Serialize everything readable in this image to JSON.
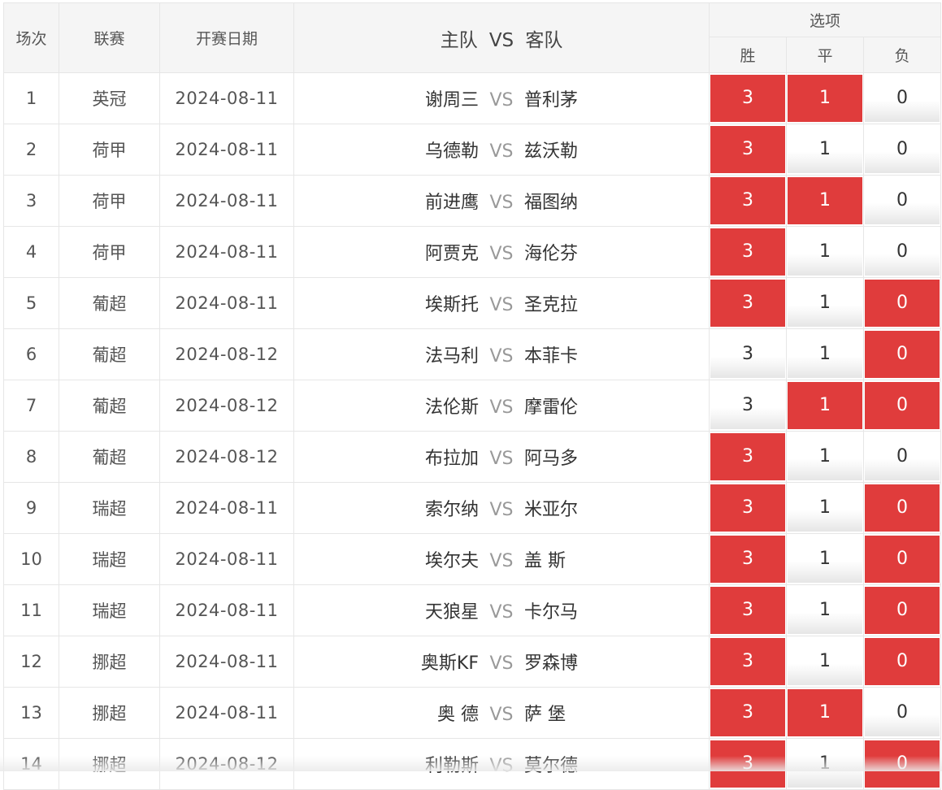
{
  "header": {
    "col_index": "场次",
    "col_league": "联赛",
    "col_date": "开赛日期",
    "col_home": "主队",
    "col_vs": "VS",
    "col_away": "客队",
    "col_options": "选项",
    "opt_win": "胜",
    "opt_draw": "平",
    "opt_lose": "负"
  },
  "colors": {
    "selected": "#e03c3c",
    "unselected": "#ffffff"
  },
  "rows": [
    {
      "idx": "1",
      "league": "英冠",
      "date": "2024-08-11",
      "home": "谢周三",
      "vs": "VS",
      "away": "普利茅",
      "win": {
        "label": "3",
        "selected": true
      },
      "draw": {
        "label": "1",
        "selected": true
      },
      "lose": {
        "label": "0",
        "selected": false
      }
    },
    {
      "idx": "2",
      "league": "荷甲",
      "date": "2024-08-11",
      "home": "乌德勒",
      "vs": "VS",
      "away": "兹沃勒",
      "win": {
        "label": "3",
        "selected": true
      },
      "draw": {
        "label": "1",
        "selected": false
      },
      "lose": {
        "label": "0",
        "selected": false
      }
    },
    {
      "idx": "3",
      "league": "荷甲",
      "date": "2024-08-11",
      "home": "前进鹰",
      "vs": "VS",
      "away": "福图纳",
      "win": {
        "label": "3",
        "selected": true
      },
      "draw": {
        "label": "1",
        "selected": true
      },
      "lose": {
        "label": "0",
        "selected": false
      }
    },
    {
      "idx": "4",
      "league": "荷甲",
      "date": "2024-08-11",
      "home": "阿贾克",
      "vs": "VS",
      "away": "海伦芬",
      "win": {
        "label": "3",
        "selected": true
      },
      "draw": {
        "label": "1",
        "selected": false
      },
      "lose": {
        "label": "0",
        "selected": false
      }
    },
    {
      "idx": "5",
      "league": "葡超",
      "date": "2024-08-11",
      "home": "埃斯托",
      "vs": "VS",
      "away": "圣克拉",
      "win": {
        "label": "3",
        "selected": true
      },
      "draw": {
        "label": "1",
        "selected": false
      },
      "lose": {
        "label": "0",
        "selected": true
      }
    },
    {
      "idx": "6",
      "league": "葡超",
      "date": "2024-08-12",
      "home": "法马利",
      "vs": "VS",
      "away": "本菲卡",
      "win": {
        "label": "3",
        "selected": false
      },
      "draw": {
        "label": "1",
        "selected": false
      },
      "lose": {
        "label": "0",
        "selected": true
      }
    },
    {
      "idx": "7",
      "league": "葡超",
      "date": "2024-08-12",
      "home": "法伦斯",
      "vs": "VS",
      "away": "摩雷伦",
      "win": {
        "label": "3",
        "selected": false
      },
      "draw": {
        "label": "1",
        "selected": true
      },
      "lose": {
        "label": "0",
        "selected": true
      }
    },
    {
      "idx": "8",
      "league": "葡超",
      "date": "2024-08-12",
      "home": "布拉加",
      "vs": "VS",
      "away": "阿马多",
      "win": {
        "label": "3",
        "selected": true
      },
      "draw": {
        "label": "1",
        "selected": false
      },
      "lose": {
        "label": "0",
        "selected": false
      }
    },
    {
      "idx": "9",
      "league": "瑞超",
      "date": "2024-08-11",
      "home": "索尔纳",
      "vs": "VS",
      "away": "米亚尔",
      "win": {
        "label": "3",
        "selected": true
      },
      "draw": {
        "label": "1",
        "selected": false
      },
      "lose": {
        "label": "0",
        "selected": true
      }
    },
    {
      "idx": "10",
      "league": "瑞超",
      "date": "2024-08-11",
      "home": "埃尔夫",
      "vs": "VS",
      "away": "盖 斯",
      "win": {
        "label": "3",
        "selected": true
      },
      "draw": {
        "label": "1",
        "selected": false
      },
      "lose": {
        "label": "0",
        "selected": true
      }
    },
    {
      "idx": "11",
      "league": "瑞超",
      "date": "2024-08-11",
      "home": "天狼星",
      "vs": "VS",
      "away": "卡尔马",
      "win": {
        "label": "3",
        "selected": true
      },
      "draw": {
        "label": "1",
        "selected": false
      },
      "lose": {
        "label": "0",
        "selected": true
      }
    },
    {
      "idx": "12",
      "league": "挪超",
      "date": "2024-08-11",
      "home": "奥斯KF",
      "vs": "VS",
      "away": "罗森博",
      "win": {
        "label": "3",
        "selected": true
      },
      "draw": {
        "label": "1",
        "selected": false
      },
      "lose": {
        "label": "0",
        "selected": true
      }
    },
    {
      "idx": "13",
      "league": "挪超",
      "date": "2024-08-11",
      "home": "奥 德",
      "vs": "VS",
      "away": "萨 堡",
      "win": {
        "label": "3",
        "selected": true
      },
      "draw": {
        "label": "1",
        "selected": true
      },
      "lose": {
        "label": "0",
        "selected": false
      }
    },
    {
      "idx": "14",
      "league": "挪超",
      "date": "2024-08-12",
      "home": "利勒斯",
      "vs": "VS",
      "away": "莫尔德",
      "win": {
        "label": "3",
        "selected": true
      },
      "draw": {
        "label": "1",
        "selected": false
      },
      "lose": {
        "label": "0",
        "selected": true
      }
    }
  ]
}
